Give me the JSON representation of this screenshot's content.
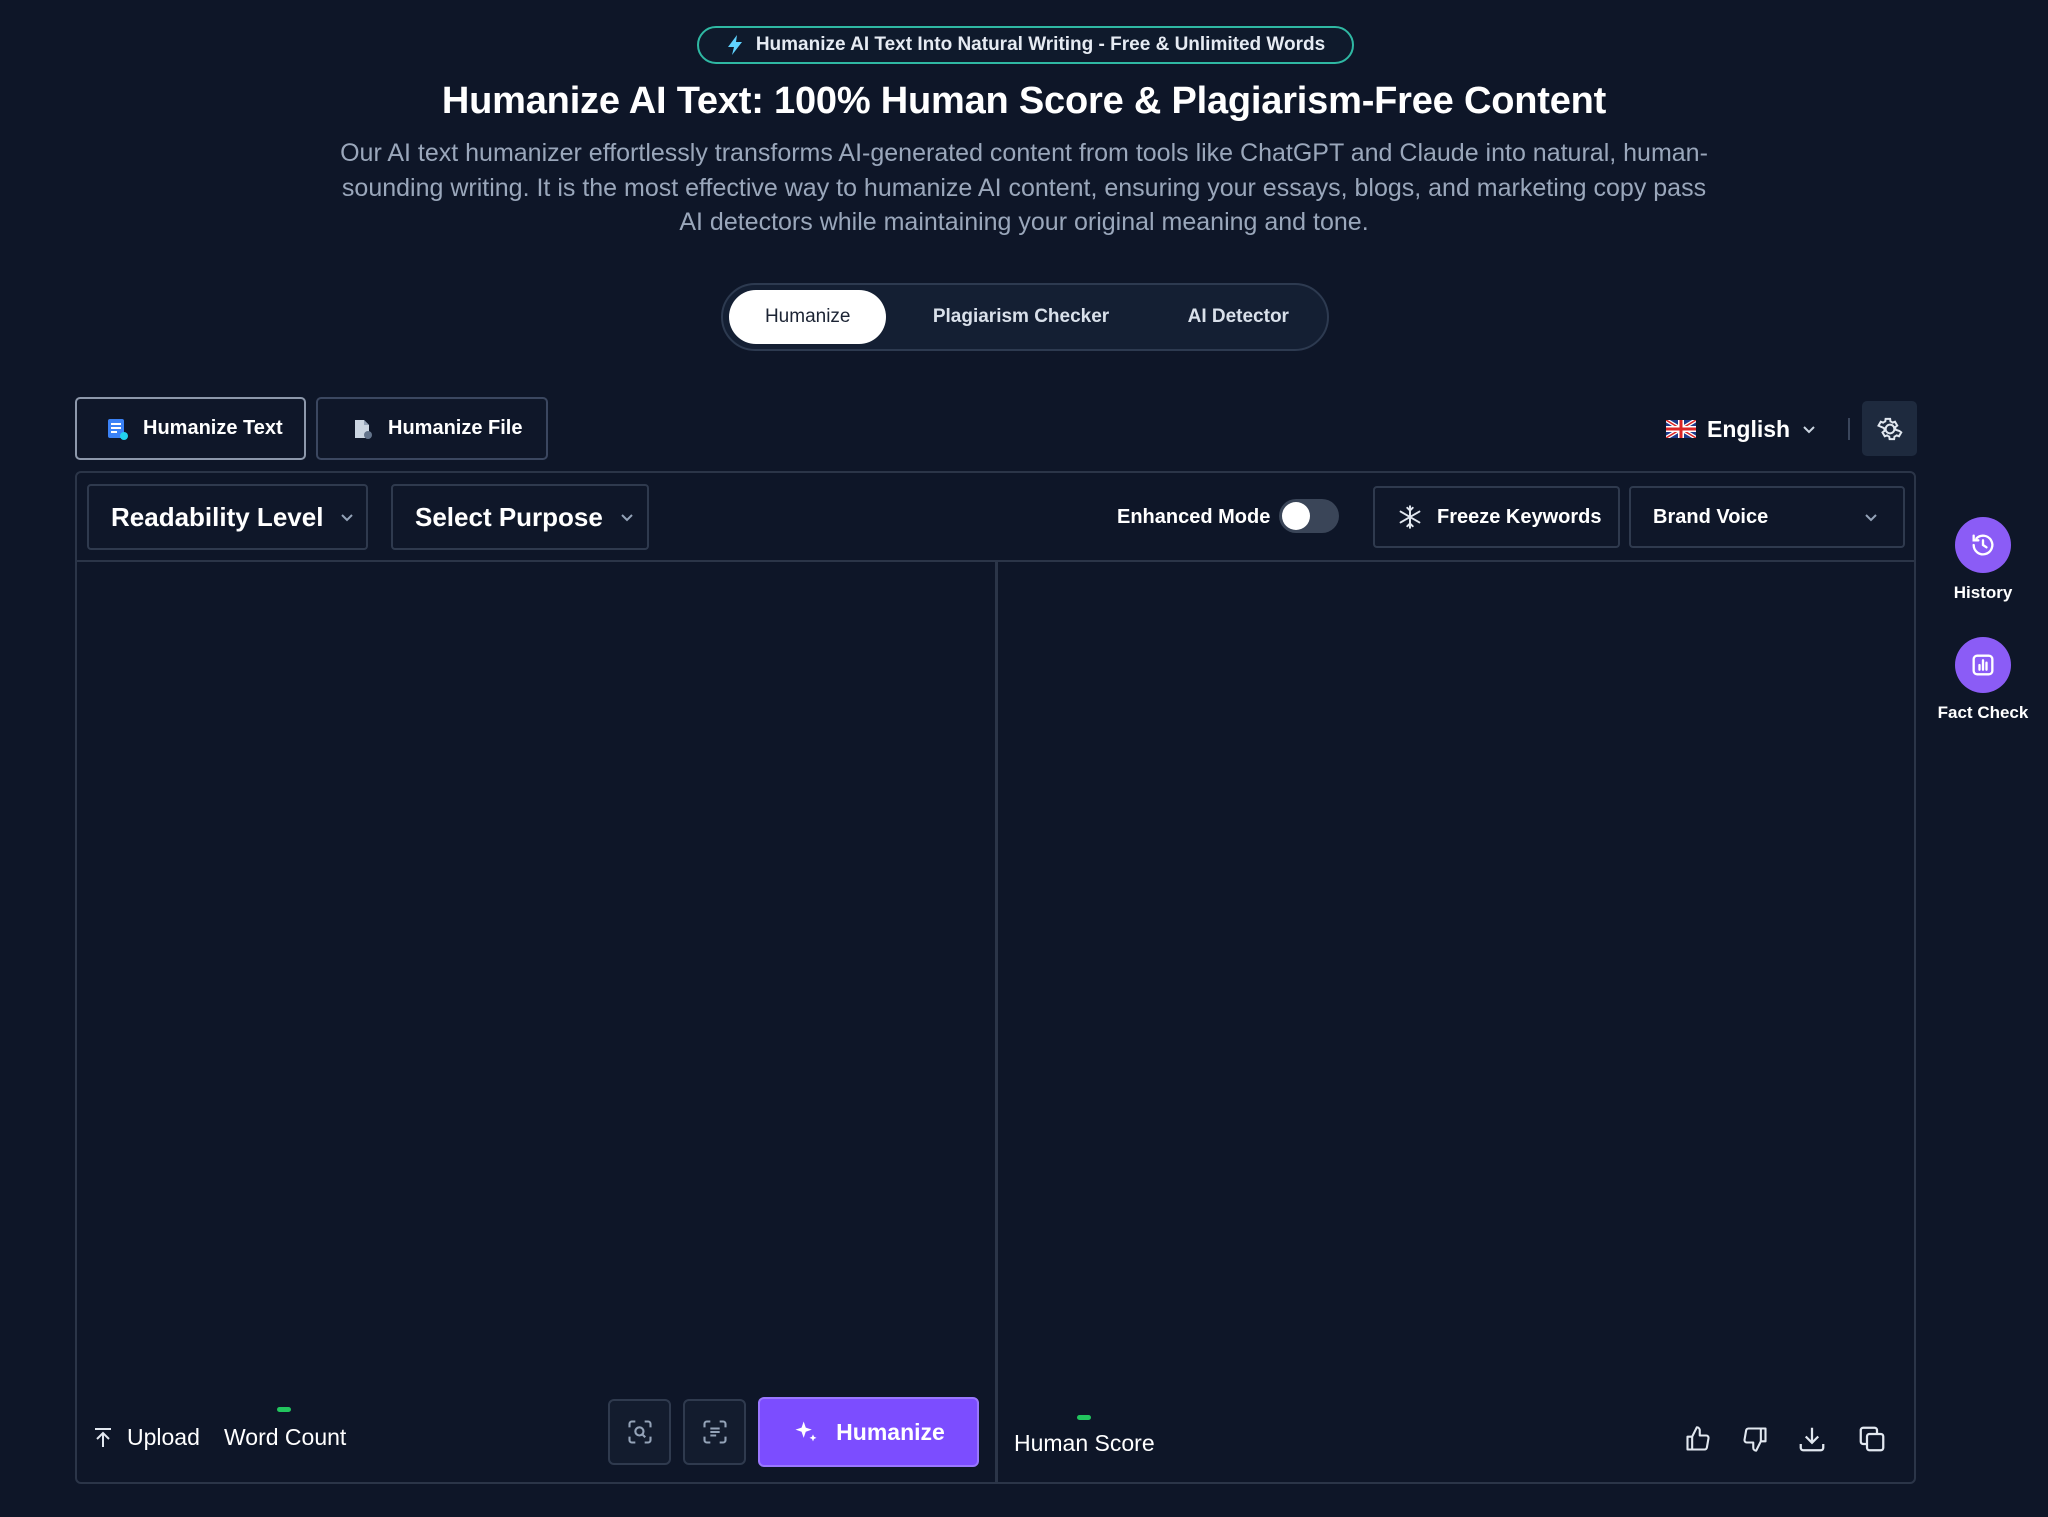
{
  "badge": {
    "text": "Humanize AI Text Into Natural Writing - Free & Unlimited Words",
    "icon": "bolt-icon"
  },
  "hero": {
    "title": "Humanize AI Text: 100% Human Score & Plagiarism-Free Content",
    "subtitle": "Our AI text humanizer effortlessly transforms AI-generated content from tools like ChatGPT and Claude into natural, human-sounding writing. It is the most effective way to humanize AI content, ensuring your essays, blogs, and marketing copy pass AI detectors while maintaining your original meaning and tone."
  },
  "tabs": [
    {
      "label": "Humanize",
      "active": true
    },
    {
      "label": "Plagiarism Checker",
      "active": false
    },
    {
      "label": "AI Detector",
      "active": false
    }
  ],
  "modes": {
    "text_label": "Humanize Text",
    "file_label": "Humanize File"
  },
  "language": {
    "selected": "English",
    "flag": "uk-flag-icon"
  },
  "toolbar": {
    "readability_label": "Readability Level",
    "purpose_label": "Select Purpose",
    "enhanced_label": "Enhanced Mode",
    "enhanced_on": false,
    "freeze_label": "Freeze Keywords",
    "brand_voice_label": "Brand Voice"
  },
  "input": {
    "value": "",
    "upload_label": "Upload",
    "word_count_label": "Word Count"
  },
  "actions": {
    "humanize_label": "Humanize"
  },
  "output": {
    "human_score_label": "Human Score"
  },
  "side": {
    "history_label": "History",
    "fact_check_label": "Fact Check"
  },
  "colors": {
    "background": "#0e1628",
    "accent": "#7c4dff",
    "side_accent": "#8b5cf6",
    "badge_border": "#2fb8a3",
    "indicator": "#22c55e"
  }
}
